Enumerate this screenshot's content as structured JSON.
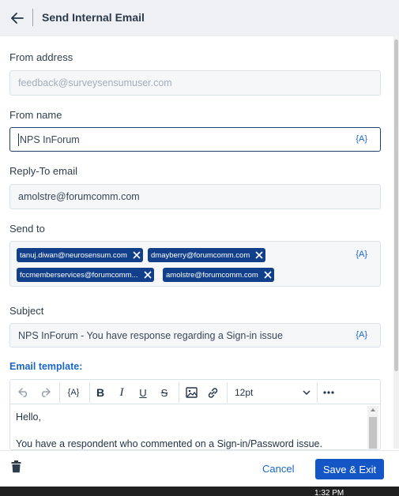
{
  "header": {
    "title": "Send Internal Email"
  },
  "from_address": {
    "label": "From address",
    "placeholder": "feedback@surveysensumuser.com"
  },
  "from_name": {
    "label": "From name",
    "value": "NPS InForum",
    "token": "{A}"
  },
  "reply_to": {
    "label": "Reply-To email",
    "value": "amolstre@forumcomm.com"
  },
  "send_to": {
    "label": "Send to",
    "token": "{A}",
    "recipients": [
      "tanuj.diwan@neurosensum.com",
      "dmayberry@forumcomm.com",
      "fccmemberservices@forumcomm...",
      "amolstre@forumcomm.com"
    ]
  },
  "subject": {
    "label": "Subject",
    "value": "NPS InForum - You have response regarding a Sign-in issue",
    "token": "{A}"
  },
  "email_template": {
    "label": "Email template:",
    "toolbar": {
      "variable": "{A}",
      "font_size": "12pt"
    },
    "lines": [
      "Hello,",
      "You have a respondent who commented on a Sign-in/Password issue."
    ]
  },
  "footer": {
    "cancel": "Cancel",
    "save": "Save & Exit"
  },
  "taskbar": {
    "clock": "1:32 PM"
  },
  "icons": [
    "back-arrow-icon",
    "undo-icon",
    "redo-icon",
    "bold-icon",
    "italic-icon",
    "underline-icon",
    "strikethrough-icon",
    "image-icon",
    "link-icon",
    "chevron-down-icon",
    "more-icon",
    "trash-icon",
    "close-icon"
  ],
  "colors": {
    "accent": "#1a66c8",
    "chip": "#123f8a",
    "primary_button": "#1456c6",
    "header_bg": "#eef0f3"
  }
}
